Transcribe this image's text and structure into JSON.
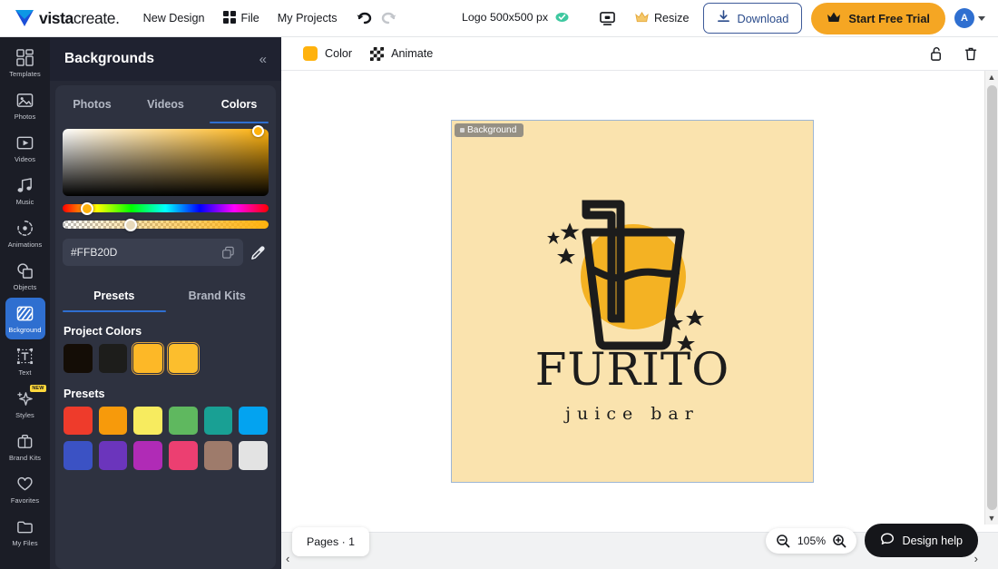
{
  "header": {
    "brand": {
      "name_bold": "vista",
      "name_thin": "create.",
      "icon": "vistacreate-logo-icon"
    },
    "nav": [
      {
        "label": "New Design",
        "icon": null
      },
      {
        "label": "File",
        "icon": "grid-icon"
      },
      {
        "label": "My Projects",
        "icon": null
      }
    ],
    "history": {
      "undo": "undo-icon",
      "redo": "redo-icon"
    },
    "document_title": "Logo 500x500 px",
    "saved_icon": "cloud-saved-icon",
    "present_icon": "present-icon",
    "resize": {
      "label": "Resize",
      "icon": "crown-icon"
    },
    "download": {
      "label": "Download",
      "icon": "download-icon"
    },
    "trial": {
      "label": "Start Free Trial",
      "icon": "crown-icon"
    },
    "avatar": {
      "initial": "A"
    }
  },
  "rail": {
    "items": [
      {
        "label": "Templates",
        "icon": "templates-icon",
        "active": false,
        "badge": null
      },
      {
        "label": "Photos",
        "icon": "photos-icon",
        "active": false,
        "badge": null
      },
      {
        "label": "Videos",
        "icon": "videos-icon",
        "active": false,
        "badge": null
      },
      {
        "label": "Music",
        "icon": "music-icon",
        "active": false,
        "badge": null
      },
      {
        "label": "Animations",
        "icon": "animations-icon",
        "active": false,
        "badge": null
      },
      {
        "label": "Objects",
        "icon": "objects-icon",
        "active": false,
        "badge": null
      },
      {
        "label": "Bckground",
        "icon": "background-icon",
        "active": true,
        "badge": null
      },
      {
        "label": "Text",
        "icon": "text-icon",
        "active": false,
        "badge": null
      },
      {
        "label": "Styles",
        "icon": "styles-icon",
        "active": false,
        "badge": "NEW"
      },
      {
        "label": "Brand Kits",
        "icon": "brandkits-icon",
        "active": false,
        "badge": null
      },
      {
        "label": "Favorites",
        "icon": "favorites-icon",
        "active": false,
        "badge": null
      },
      {
        "label": "My Files",
        "icon": "myfiles-icon",
        "active": false,
        "badge": null
      }
    ]
  },
  "panel": {
    "title": "Backgrounds",
    "collapse_icon": "double-chevron-left-icon",
    "tabs": [
      {
        "label": "Photos",
        "active": false
      },
      {
        "label": "Videos",
        "active": false
      },
      {
        "label": "Colors",
        "active": true
      }
    ],
    "picker": {
      "current_color": "#FFB20D",
      "hex_value": "#FFB20D",
      "copy_icon": "copy-icon",
      "eyedropper_icon": "eyedropper-icon",
      "hue_position_pct": 9,
      "alpha_position_pct": 30
    },
    "sub_tabs": [
      {
        "label": "Presets",
        "active": true
      },
      {
        "label": "Brand Kits",
        "active": false
      }
    ],
    "project_colors": {
      "title": "Project Colors",
      "swatches": [
        "#140D06",
        "#1D1D1B",
        "#FDB827",
        "#FCBE2D"
      ]
    },
    "presets": {
      "title": "Presets",
      "swatches": [
        "#EE3B2B",
        "#F79A0B",
        "#F7EB5F",
        "#5FB85F",
        "#19A094",
        "#03A3F0",
        "#3B52C4",
        "#6B35BC",
        "#B02BB6",
        "#EC3F71",
        "#9E7B6B",
        "#E3E3E3"
      ]
    }
  },
  "context_toolbar": {
    "color": {
      "label": "Color",
      "swatch": "#FFB20D"
    },
    "animate": {
      "label": "Animate",
      "icon": "checker-icon"
    },
    "lock_icon": "unlock-icon",
    "delete_icon": "trash-icon"
  },
  "canvas": {
    "artboard_label": "Background",
    "background_color": "#FAE3AE",
    "logo": {
      "brand_name": "FURITO",
      "tagline": "juice bar",
      "circle_color": "#F4B223",
      "stroke_color": "#1C1C1C"
    }
  },
  "bottom_bar": {
    "pages_label": "Pages · 1",
    "prev_icon": "chevron-left-icon",
    "next_icon": "chevron-right-icon",
    "zoom": {
      "value": "105%",
      "out_icon": "zoom-out-icon",
      "in_icon": "zoom-in-icon"
    },
    "design_help": {
      "label": "Design help",
      "icon": "chat-icon"
    }
  }
}
